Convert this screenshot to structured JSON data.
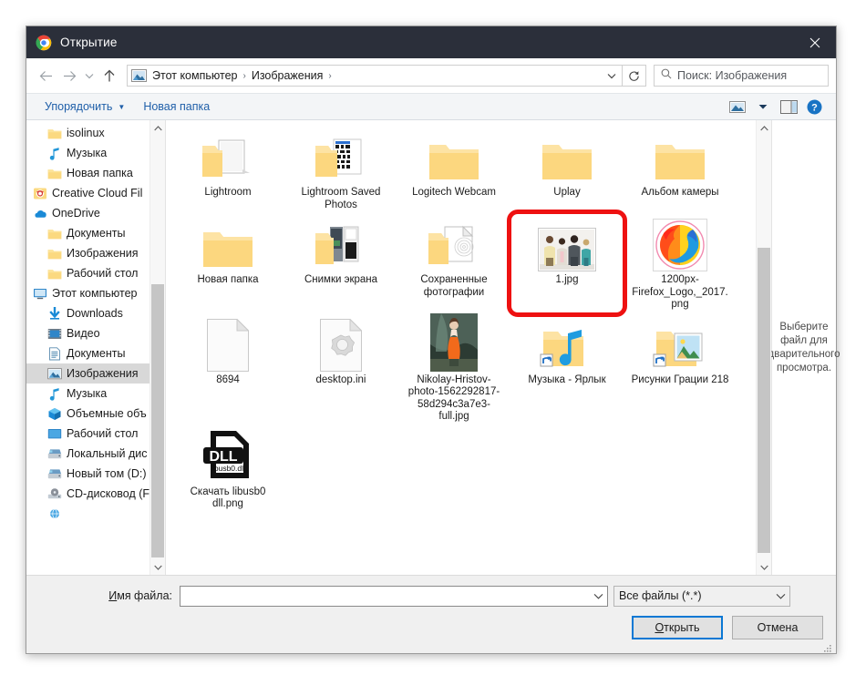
{
  "window": {
    "title": "Открытие",
    "icon": "chrome-icon",
    "close_label": "✕"
  },
  "nav": {
    "back_icon": "arrow-left-icon",
    "forward_icon": "arrow-right-icon",
    "history_icon": "chevron-down-icon",
    "up_icon": "arrow-up-icon",
    "refresh_icon": "refresh-icon",
    "breadcrumb_icon": "pictures-folder-icon",
    "breadcrumb": [
      "Этот компьютер",
      "Изображения"
    ],
    "breadcrumb_separator": "›",
    "dropdown_icon": "chevron-down-icon"
  },
  "search": {
    "icon": "search-icon",
    "placeholder": "Поиск: Изображения",
    "value": ""
  },
  "commandbar": {
    "organize": "Упорядочить",
    "organize_caret": "▼",
    "new_folder": "Новая папка",
    "view_icon": "view-layout-icon",
    "view_caret": "▼",
    "preview_pane_icon": "preview-pane-icon",
    "help_icon": "help-icon"
  },
  "sidebar": {
    "items": [
      {
        "label": "isolinux",
        "icon": "folder-icon",
        "indent": 1,
        "selected": false
      },
      {
        "label": "Музыка",
        "icon": "music-icon",
        "indent": 1,
        "selected": false
      },
      {
        "label": "Новая папка",
        "icon": "folder-icon",
        "indent": 1,
        "selected": false
      },
      {
        "label": "Creative Cloud Fil",
        "icon": "creative-cloud-icon",
        "indent": 0,
        "selected": false
      },
      {
        "label": "OneDrive",
        "icon": "onedrive-icon",
        "indent": 0,
        "selected": false
      },
      {
        "label": "Документы",
        "icon": "folder-icon",
        "indent": 1,
        "selected": false
      },
      {
        "label": "Изображения",
        "icon": "folder-icon",
        "indent": 1,
        "selected": false
      },
      {
        "label": "Рабочий стол",
        "icon": "folder-icon",
        "indent": 1,
        "selected": false
      },
      {
        "label": "Этот компьютер",
        "icon": "this-pc-icon",
        "indent": 0,
        "selected": false
      },
      {
        "label": "Downloads",
        "icon": "downloads-icon",
        "indent": 1,
        "selected": false
      },
      {
        "label": "Видео",
        "icon": "videos-icon",
        "indent": 1,
        "selected": false
      },
      {
        "label": "Документы",
        "icon": "documents-icon",
        "indent": 1,
        "selected": false
      },
      {
        "label": "Изображения",
        "icon": "pictures-icon",
        "indent": 1,
        "selected": true
      },
      {
        "label": "Музыка",
        "icon": "music-icon",
        "indent": 1,
        "selected": false
      },
      {
        "label": "Объемные объ",
        "icon": "3d-objects-icon",
        "indent": 1,
        "selected": false
      },
      {
        "label": "Рабочий стол",
        "icon": "desktop-icon",
        "indent": 1,
        "selected": false
      },
      {
        "label": "Локальный дис",
        "icon": "drive-icon",
        "indent": 1,
        "selected": false
      },
      {
        "label": "Новый том (D:)",
        "icon": "drive-icon",
        "indent": 1,
        "selected": false
      },
      {
        "label": "CD-дисковод (F:",
        "icon": "cd-drive-icon",
        "indent": 1,
        "selected": false
      },
      {
        "label": "",
        "icon": "network-icon",
        "indent": 1,
        "selected": false
      }
    ],
    "scroll_up_icon": "chevron-up-icon",
    "scroll_down_icon": "chevron-down-icon"
  },
  "files": {
    "rows": [
      [
        {
          "label": "Lightroom",
          "icon": "folder-stack-icon",
          "selected": false
        },
        {
          "label": "Lightroom Saved Photos",
          "icon": "folder-qr-icon",
          "selected": false
        },
        {
          "label": "Logitech Webcam",
          "icon": "folder-icon",
          "selected": false
        },
        {
          "label": "Uplay",
          "icon": "folder-icon",
          "selected": false
        },
        {
          "label": "Альбом камеры",
          "icon": "folder-icon",
          "selected": false
        }
      ],
      [
        {
          "label": "Новая папка",
          "icon": "folder-icon",
          "selected": false
        },
        {
          "label": "Снимки экрана",
          "icon": "folder-screens-icon",
          "selected": false
        },
        {
          "label": "Сохраненные фотографии",
          "icon": "folder-docs-icon",
          "selected": false
        },
        {
          "label": "1.jpg",
          "icon": "photo-people-icon",
          "selected": true
        },
        {
          "label": "1200px-Firefox_Logo,_2017.png",
          "icon": "firefox-icon",
          "selected": false
        }
      ],
      [
        {
          "label": "8694",
          "icon": "blank-file-icon",
          "selected": false
        },
        {
          "label": "desktop.ini",
          "icon": "ini-file-icon",
          "selected": false
        },
        {
          "label": "Nikolay-Hristov-photo-1562292817-58d294c3a7e3-full.jpg",
          "icon": "photo-woman-icon",
          "selected": false
        },
        {
          "label": "Музыка - Ярлык",
          "icon": "folder-music-shortcut-icon",
          "selected": false
        },
        {
          "label": "Рисунки Грации 218",
          "icon": "folder-pictures-shortcut-icon",
          "selected": false
        }
      ],
      [
        {
          "label": "Скачать libusb0 dll.png",
          "icon": "dll-png-icon",
          "selected": false
        }
      ]
    ],
    "scroll_up_icon": "chevron-up-icon",
    "scroll_down_icon": "chevron-down-icon"
  },
  "preview": {
    "text": "Выберите файл для двaрительного просмотра."
  },
  "footer": {
    "filename_label_prefix": "И",
    "filename_label_rest": "мя файла:",
    "filename_value": "",
    "filename_caret": "⌄",
    "filter_value": "Все файлы (*.*)",
    "filter_caret": "⌄",
    "open_label_prefix": "О",
    "open_label_rest": "ткрыть",
    "cancel_label": "Отмена",
    "resize_grip_icon": "resize-grip-icon"
  },
  "annotation": {
    "highlight_color": "#ee1111",
    "target": "1.jpg"
  },
  "colors": {
    "titlebar_bg": "#2b2f3a",
    "accent_blue": "#0a78d4",
    "link_blue": "#1f5fa9",
    "selection_gray": "#d8d8d8"
  }
}
